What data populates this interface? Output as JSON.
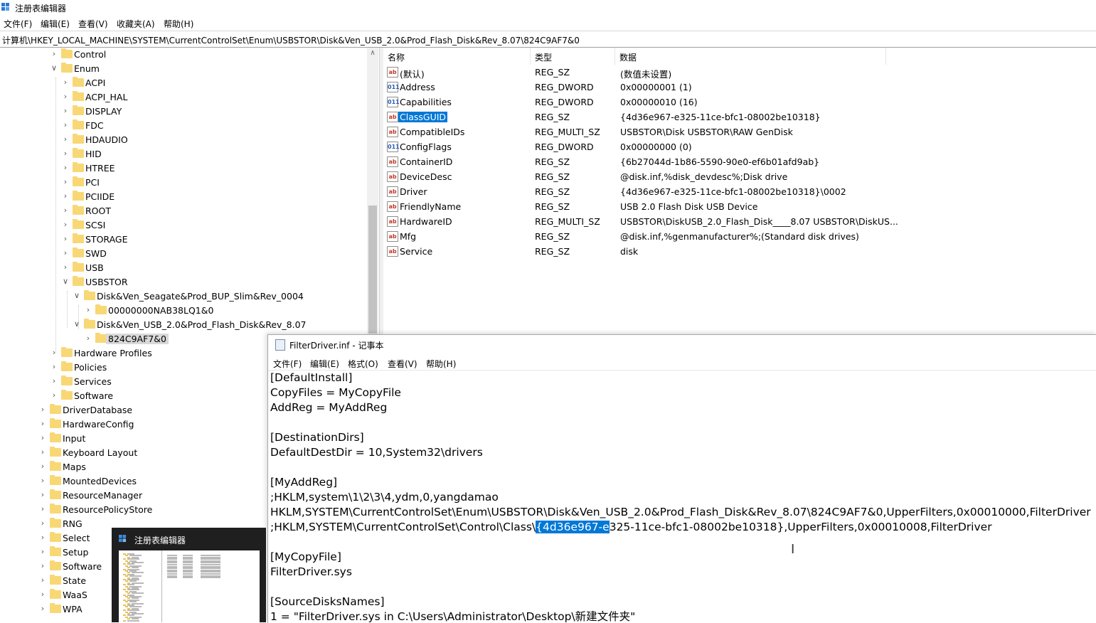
{
  "window": {
    "title": "注册表编辑器",
    "menu": [
      "文件(F)",
      "编辑(E)",
      "查看(V)",
      "收藏夹(A)",
      "帮助(H)"
    ]
  },
  "address": "计算机\\HKEY_LOCAL_MACHINE\\SYSTEM\\CurrentControlSet\\Enum\\USBSTOR\\Disk&Ven_USB_2.0&Prod_Flash_Disk&Rev_8.07\\824C9AF7&0",
  "tree": {
    "nodes": [
      {
        "label": "Control",
        "expanded": false
      },
      {
        "label": "Enum",
        "expanded": true
      },
      {
        "label": "ACPI",
        "expanded": false
      },
      {
        "label": "ACPI_HAL",
        "expanded": false
      },
      {
        "label": "DISPLAY",
        "expanded": false
      },
      {
        "label": "FDC",
        "expanded": false
      },
      {
        "label": "HDAUDIO",
        "expanded": false
      },
      {
        "label": "HID",
        "expanded": false
      },
      {
        "label": "HTREE",
        "expanded": false
      },
      {
        "label": "PCI",
        "expanded": false
      },
      {
        "label": "PCIIDE",
        "expanded": false
      },
      {
        "label": "ROOT",
        "expanded": false
      },
      {
        "label": "SCSI",
        "expanded": false
      },
      {
        "label": "STORAGE",
        "expanded": false
      },
      {
        "label": "SWD",
        "expanded": false
      },
      {
        "label": "USB",
        "expanded": false
      },
      {
        "label": "USBSTOR",
        "expanded": true
      },
      {
        "label": "Disk&Ven_Seagate&Prod_BUP_Slim&Rev_0004",
        "expanded": true
      },
      {
        "label": "00000000NAB38LQ1&0",
        "expanded": false
      },
      {
        "label": "Disk&Ven_USB_2.0&Prod_Flash_Disk&Rev_8.07",
        "expanded": true
      },
      {
        "label": "824C9AF7&0",
        "expanded": false,
        "selected": true
      },
      {
        "label": "Hardware Profiles",
        "expanded": false
      },
      {
        "label": "Policies",
        "expanded": false
      },
      {
        "label": "Services",
        "expanded": false
      },
      {
        "label": "Software",
        "expanded": false
      },
      {
        "label": "DriverDatabase",
        "expanded": false
      },
      {
        "label": "HardwareConfig",
        "expanded": false
      },
      {
        "label": "Input",
        "expanded": false
      },
      {
        "label": "Keyboard Layout",
        "expanded": false
      },
      {
        "label": "Maps",
        "expanded": false
      },
      {
        "label": "MountedDevices",
        "expanded": false
      },
      {
        "label": "ResourceManager",
        "expanded": false
      },
      {
        "label": "ResourcePolicyStore",
        "expanded": false
      },
      {
        "label": "RNG",
        "expanded": false
      },
      {
        "label": "Select",
        "expanded": false
      },
      {
        "label": "Setup",
        "expanded": false
      },
      {
        "label": "Software",
        "expanded": false
      },
      {
        "label": "State",
        "expanded": false
      },
      {
        "label": "WaaS",
        "expanded": false
      },
      {
        "label": "WPA",
        "expanded": false
      }
    ]
  },
  "values": {
    "headers": {
      "name": "名称",
      "type": "类型",
      "data": "数据"
    },
    "rows": [
      {
        "icon": "ab",
        "name": "(默认)",
        "type": "REG_SZ",
        "data": "(数值未设置)"
      },
      {
        "icon": "bin",
        "name": "Address",
        "type": "REG_DWORD",
        "data": "0x00000001 (1)"
      },
      {
        "icon": "bin",
        "name": "Capabilities",
        "type": "REG_DWORD",
        "data": "0x00000010 (16)"
      },
      {
        "icon": "ab",
        "name": "ClassGUID",
        "type": "REG_SZ",
        "data": "{4d36e967-e325-11ce-bfc1-08002be10318}",
        "selected": true
      },
      {
        "icon": "ab",
        "name": "CompatibleIDs",
        "type": "REG_MULTI_SZ",
        "data": "USBSTOR\\Disk USBSTOR\\RAW GenDisk"
      },
      {
        "icon": "bin",
        "name": "ConfigFlags",
        "type": "REG_DWORD",
        "data": "0x00000000 (0)"
      },
      {
        "icon": "ab",
        "name": "ContainerID",
        "type": "REG_SZ",
        "data": "{6b27044d-1b86-5590-90e0-ef6b01afd9ab}"
      },
      {
        "icon": "ab",
        "name": "DeviceDesc",
        "type": "REG_SZ",
        "data": "@disk.inf,%disk_devdesc%;Disk drive"
      },
      {
        "icon": "ab",
        "name": "Driver",
        "type": "REG_SZ",
        "data": "{4d36e967-e325-11ce-bfc1-08002be10318}\\0002"
      },
      {
        "icon": "ab",
        "name": "FriendlyName",
        "type": "REG_SZ",
        "data": "USB 2.0 Flash Disk USB Device"
      },
      {
        "icon": "ab",
        "name": "HardwareID",
        "type": "REG_MULTI_SZ",
        "data": "USBSTOR\\DiskUSB_2.0_Flash_Disk____8.07 USBSTOR\\DiskUS..."
      },
      {
        "icon": "ab",
        "name": "Mfg",
        "type": "REG_SZ",
        "data": "@disk.inf,%genmanufacturer%;(Standard disk drives)"
      },
      {
        "icon": "ab",
        "name": "Service",
        "type": "REG_SZ",
        "data": "disk"
      }
    ]
  },
  "notepad": {
    "title": "FilterDriver.inf - 记事本",
    "menu": [
      "文件(F)",
      "编辑(E)",
      "格式(O)",
      "查看(V)",
      "帮助(H)"
    ],
    "lines": [
      "[DefaultInstall]",
      "CopyFiles = MyCopyFile",
      "AddReg = MyAddReg",
      "",
      "[DestinationDirs]",
      "DefaultDestDir = 10,System32\\drivers",
      "",
      "[MyAddReg]",
      ";HKLM,system\\1\\2\\3\\4,ydm,0,yangdamao",
      "HKLM,SYSTEM\\CurrentControlSet\\Enum\\USBSTOR\\Disk&Ven_USB_2.0&Prod_Flash_Disk&Rev_8.07\\824C9AF7&0,UpperFilters,0x00010000,FilterDriver",
      "",
      "",
      "[MyCopyFile]",
      "FilterDriver.sys",
      "",
      "[SourceDisksNames]",
      "1 = \"FilterDriver.sys in C:\\Users\\Administrator\\Desktop\\新建文件夹\""
    ],
    "selection_line": {
      "before": ";HKLM,SYSTEM\\CurrentControlSet\\Control\\Class\\",
      "selected": "{4d36e967-e",
      "after": "325-11ce-bfc1-08002be10318},UpperFilters,0x00010008,FilterDriver"
    }
  },
  "taskbar_thumbnail": {
    "title": "注册表编辑器"
  },
  "colors": {
    "selection": "#0078d7",
    "folder": "#f8d775"
  }
}
